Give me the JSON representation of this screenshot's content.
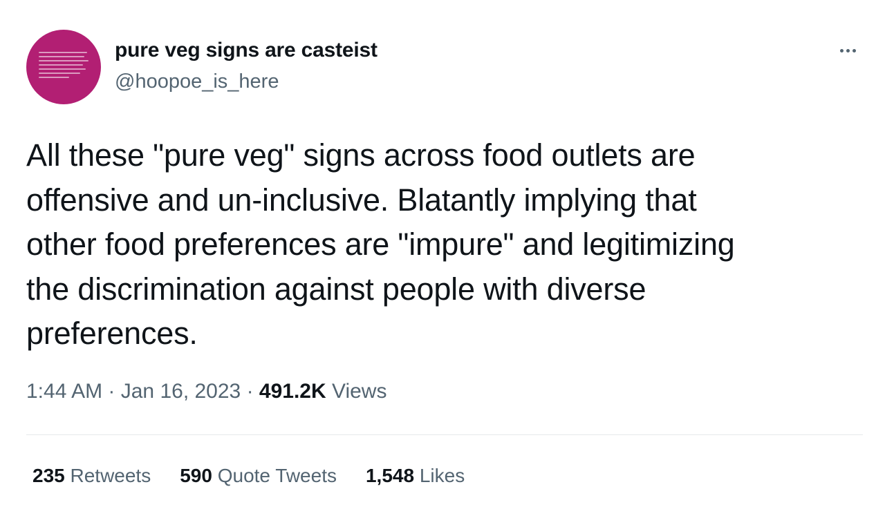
{
  "author": {
    "display_name": "pure veg signs are casteist",
    "handle": "@hoopoe_is_here",
    "avatar_color": "#b21f73"
  },
  "tweet": {
    "text": "All these \"pure veg\" signs across food outlets are\noffensive and un-inclusive. Blatantly implying that\nother food preferences are \"impure\" and legitimizing\nthe discrimination against people with diverse\npreferences."
  },
  "meta": {
    "time": "1:44 AM",
    "separator1": " · ",
    "date": "Jan 16, 2023",
    "separator2": " · ",
    "views_count": "491.2K",
    "views_label": " Views"
  },
  "stats": {
    "retweets": {
      "count": "235",
      "label": " Retweets"
    },
    "quote_tweets": {
      "count": "590",
      "label": " Quote Tweets"
    },
    "likes": {
      "count": "1,548",
      "label": " Likes"
    }
  },
  "icons": {
    "more": "more-icon"
  }
}
